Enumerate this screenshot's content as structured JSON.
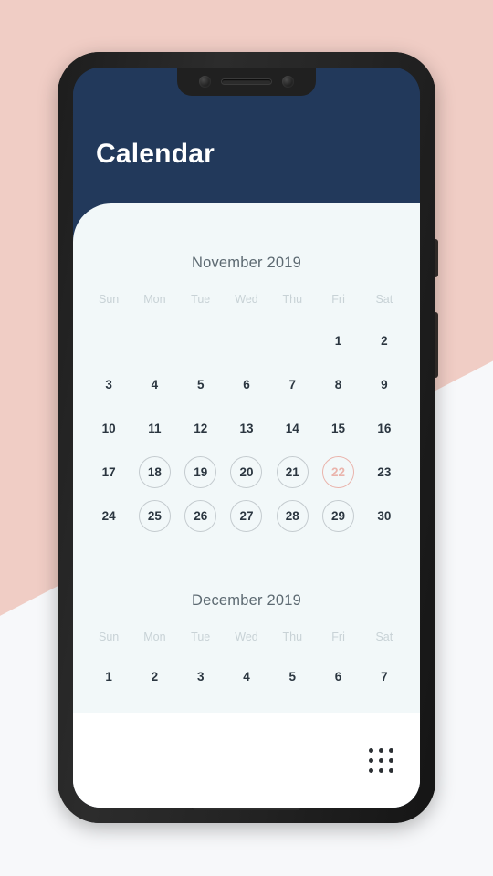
{
  "app": {
    "title": "Calendar",
    "header_color": "#22395b",
    "card_color": "#f2f8f9",
    "accent_color": "#eab4ac",
    "background_pink": "#f0cdc5",
    "background_white": "#f7f8fa"
  },
  "weekdays": [
    "Sun",
    "Mon",
    "Tue",
    "Wed",
    "Thu",
    "Fri",
    "Sat"
  ],
  "months": [
    {
      "title": "November 2019",
      "weeks": [
        [
          {
            "label": "",
            "state": "empty"
          },
          {
            "label": "",
            "state": "empty"
          },
          {
            "label": "",
            "state": "empty"
          },
          {
            "label": "",
            "state": "empty"
          },
          {
            "label": "",
            "state": "empty"
          },
          {
            "label": "1",
            "state": "plain"
          },
          {
            "label": "2",
            "state": "plain"
          }
        ],
        [
          {
            "label": "3",
            "state": "plain"
          },
          {
            "label": "4",
            "state": "plain"
          },
          {
            "label": "5",
            "state": "plain"
          },
          {
            "label": "6",
            "state": "plain"
          },
          {
            "label": "7",
            "state": "plain"
          },
          {
            "label": "8",
            "state": "plain"
          },
          {
            "label": "9",
            "state": "plain"
          }
        ],
        [
          {
            "label": "10",
            "state": "plain"
          },
          {
            "label": "11",
            "state": "plain"
          },
          {
            "label": "12",
            "state": "plain"
          },
          {
            "label": "13",
            "state": "plain"
          },
          {
            "label": "14",
            "state": "plain"
          },
          {
            "label": "15",
            "state": "plain"
          },
          {
            "label": "16",
            "state": "plain"
          }
        ],
        [
          {
            "label": "17",
            "state": "plain"
          },
          {
            "label": "18",
            "state": "circled"
          },
          {
            "label": "19",
            "state": "circled"
          },
          {
            "label": "20",
            "state": "circled"
          },
          {
            "label": "21",
            "state": "circled"
          },
          {
            "label": "22",
            "state": "accent"
          },
          {
            "label": "23",
            "state": "plain"
          }
        ],
        [
          {
            "label": "24",
            "state": "plain"
          },
          {
            "label": "25",
            "state": "circled"
          },
          {
            "label": "26",
            "state": "circled"
          },
          {
            "label": "27",
            "state": "circled"
          },
          {
            "label": "28",
            "state": "circled"
          },
          {
            "label": "29",
            "state": "circled"
          },
          {
            "label": "30",
            "state": "plain"
          }
        ]
      ]
    },
    {
      "title": "December 2019",
      "weeks": [
        [
          {
            "label": "1",
            "state": "plain"
          },
          {
            "label": "2",
            "state": "plain"
          },
          {
            "label": "3",
            "state": "plain"
          },
          {
            "label": "4",
            "state": "plain"
          },
          {
            "label": "5",
            "state": "plain"
          },
          {
            "label": "6",
            "state": "plain"
          },
          {
            "label": "7",
            "state": "plain"
          }
        ]
      ]
    }
  ],
  "bottom_bar": {
    "grid_icon": "apps-grid-icon"
  }
}
